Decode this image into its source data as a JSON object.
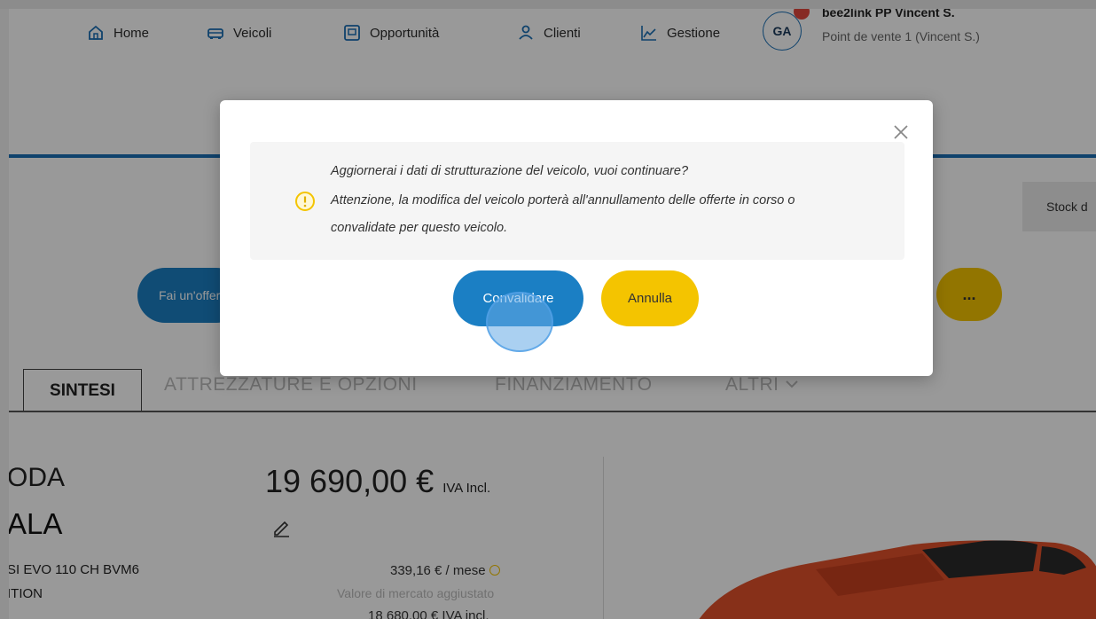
{
  "nav": {
    "items": [
      {
        "label": "Home",
        "icon": "home-icon"
      },
      {
        "label": "Veicoli",
        "icon": "car-icon"
      },
      {
        "label": "Opportunità",
        "icon": "document-icon"
      },
      {
        "label": "Clienti",
        "icon": "user-icon"
      },
      {
        "label": "Gestione",
        "icon": "chart-line-icon"
      }
    ],
    "user": {
      "initials": "GA",
      "name": "bee2link PP Vincent S.",
      "store": "Point de vente 1 (Vincent S.)"
    }
  },
  "toolbar": {
    "stock_label": "Stock d",
    "offer_label": "Fai un'offerta",
    "more_label": "..."
  },
  "tabs": {
    "active": "SINTESI",
    "items": [
      "ATTREZZATURE E OPZIONI",
      "FINANZIAMENTO",
      "ALTRI"
    ]
  },
  "vehicle": {
    "brand": "ODA",
    "model": "ALA",
    "version": "SI EVO 110 CH BVM6",
    "edition": "ITION",
    "price": "19 690,00 €",
    "price_suffix": "IVA Incl.",
    "monthly": "339,16 € / mese",
    "market_label": "Valore di mercato aggiustato",
    "market_value": "18 680,00 € IVA incl."
  },
  "modal": {
    "line1": "Aggiornerai i dati di strutturazione del veicolo, vuoi continuare?",
    "line2": "Attenzione, la modifica del veicolo porterà all'annullamento delle offerte in corso o",
    "line3": "convalidate per questo veicolo.",
    "confirm_label": "Convalidare",
    "cancel_label": "Annulla"
  },
  "colors": {
    "primary": "#1b7fc4",
    "accent": "#f4c400",
    "badge": "#e2463c"
  }
}
